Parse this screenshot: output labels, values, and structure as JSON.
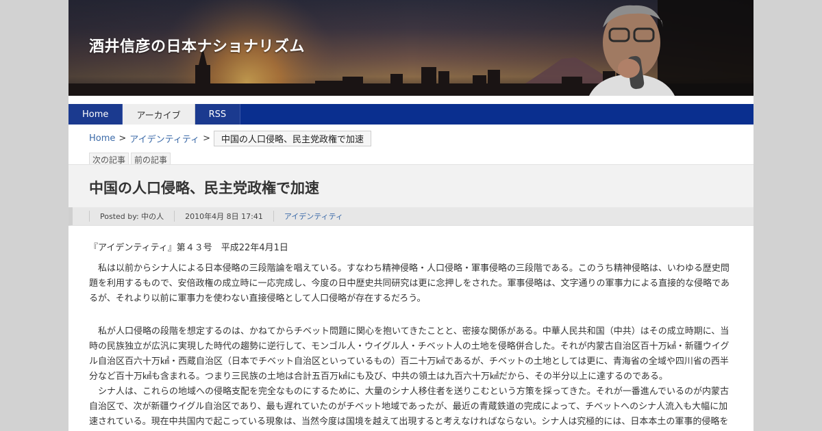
{
  "site": {
    "title": "酒井信彦の日本ナショナリズム"
  },
  "nav": {
    "items": [
      {
        "label": "Home",
        "active": false
      },
      {
        "label": "アーカイブ",
        "active": true
      },
      {
        "label": "RSS",
        "active": false
      }
    ]
  },
  "breadcrumb": {
    "home": "Home",
    "sep": ">",
    "category": "アイデンティティ",
    "current": "中国の人口侵略、民主党政権で加速"
  },
  "article_nav": {
    "next": "次の記事",
    "prev": "前の記事"
  },
  "post": {
    "title": "中国の人口侵略、民主党政権で加速",
    "posted_by": "Posted by: 中の人",
    "date": "2010年4月 8日 17:41",
    "category": "アイデンティティ"
  },
  "body": {
    "issue": "『アイデンティティ』第４３号　平成22年4月1日",
    "para1": "　私は以前からシナ人による日本侵略の三段階論を唱えている。すなわち精神侵略・人口侵略・軍事侵略の三段階である。このうち精神侵略は、いわゆる歴史問題を利用するもので、安倍政権の成立時に一応完成し、今度の日中歴史共同研究は更に念押しをされた。軍事侵略は、文字通りの軍事力による直接的な侵略であるが、それより以前に軍事力を使わない直接侵略として人口侵略が存在するだろう。",
    "para2": "　私が人口侵略の段階を想定するのは、かねてからチベット問題に関心を抱いてきたことと、密接な関係がある。中華人民共和国（中共）はその成立時期に、当時の民族独立が広汎に実現した時代の趨勢に逆行して、モンゴル人・ウイグル人・チベット人の土地を侵略併合した。それが内蒙古自治区百十万㎢・新疆ウイグル自治区百六十万㎢・西蔵自治区（日本でチベット自治区といっているもの）百二十万㎢であるが、チベットの土地としては更に、青海省の全域や四川省の西半分など百十万㎢も含まれる。つまり三民族の土地は合計五百万㎢にも及び、中共の領土は九百六十万㎢だから、その半分以上に達するのである。",
    "para3": "　シナ人は、これらの地域への侵略支配を完全なものにするために、大量のシナ人移住者を送りこむという方策を採ってきた。それが一番進んでいるのが内蒙古自治区で、次が新疆ウイグル自治区であり、最も遅れていたのがチベット地域であったが、最近の青蔵鉄道の完成によって、チベットへのシナ人流入も大幅に加速されている。現在中共国内で起こっている現象は、当然今度は国境を越えて出現すると考えなければならない。シナ人は究極的には、日本本土の軍事的侵略を"
  },
  "colors": {
    "nav_bg": "#0a2f8f",
    "link": "#3b6aa8",
    "page_bg": "#d2d2d2"
  }
}
